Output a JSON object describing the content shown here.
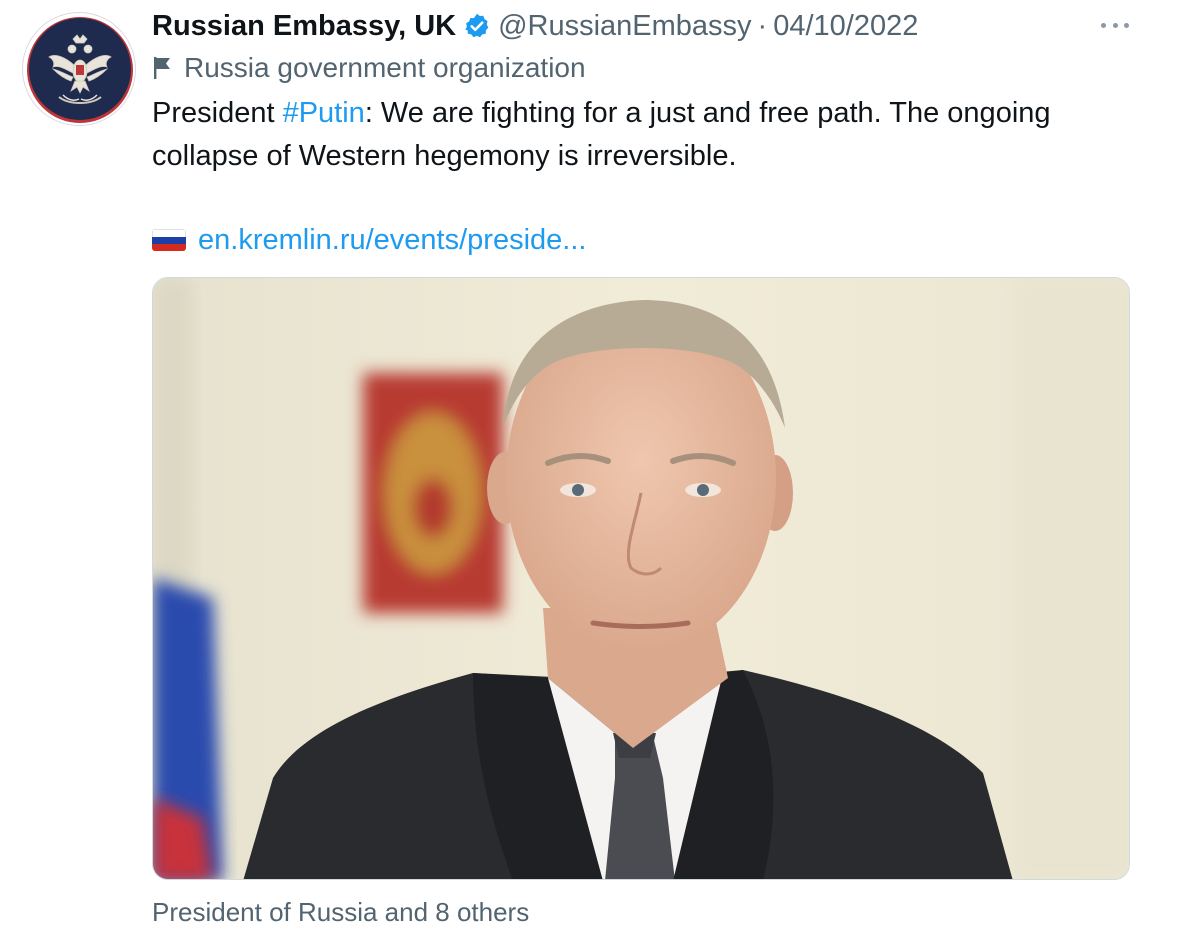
{
  "tweet": {
    "display_name": "Russian Embassy, UK",
    "handle": "@RussianEmbassy",
    "separator": "·",
    "date": "04/10/2022",
    "label": "Russia government organization",
    "text_prefix": "President ",
    "hashtag": "#Putin",
    "text_suffix": ": We are fighting for a just and free path. The ongoing collapse of Western hegemony is irreversible.",
    "link_text": "en.kremlin.ru/events/preside...",
    "media_caption": "President of Russia and 8 others"
  },
  "icons": {
    "verified": "verified-badge-icon",
    "label": "flag-icon",
    "link_flag": "russia-flag-emoji",
    "more": "more-options-icon"
  },
  "colors": {
    "accent": "#1d9bf0",
    "secondary_text": "#536471",
    "avatar_bg": "#1f2b4e",
    "avatar_ring": "#c0353a"
  }
}
